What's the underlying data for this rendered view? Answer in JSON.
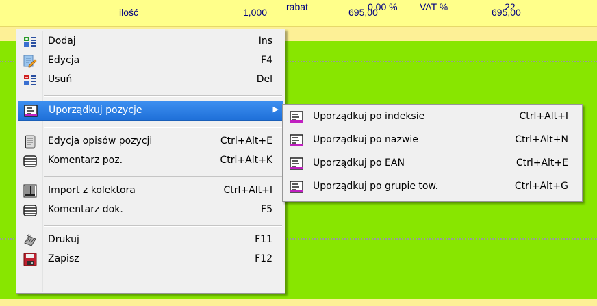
{
  "document": {
    "row1": {
      "label": "ilość",
      "qty": "1,000",
      "price": "695,00",
      "value": "695,00"
    },
    "row2": {
      "label": "rabat",
      "discount": "0,00 %",
      "vat_label": "VAT %",
      "vat": "22"
    }
  },
  "colors": {
    "highlight": "#1e6fd8",
    "workspace_green": "#88e600",
    "row_yellow": "#ffff8a",
    "menu_bg": "#f0f0f0"
  },
  "context_menu": {
    "items": [
      {
        "label": "Dodaj",
        "shortcut": "Ins",
        "icon": "add-row-icon"
      },
      {
        "label": "Edycja",
        "shortcut": "F4",
        "icon": "edit-pencil-icon"
      },
      {
        "label": "Usuń",
        "shortcut": "Del",
        "icon": "delete-row-icon"
      },
      {
        "label": "Uporządkuj pozycje",
        "shortcut": "",
        "icon": "sort-list-icon",
        "highlighted": true,
        "submenu_arrow": "▶"
      },
      {
        "label": "Edycja opisów pozycji",
        "shortcut": "Ctrl+Alt+E",
        "icon": "document-edit-icon"
      },
      {
        "label": "Komentarz poz.",
        "shortcut": "Ctrl+Alt+K",
        "icon": "comment-lines-icon"
      },
      {
        "label": "Import z kolektora",
        "shortcut": "Ctrl+Alt+I",
        "icon": "barcode-icon"
      },
      {
        "label": "Komentarz dok.",
        "shortcut": "F5",
        "icon": "comment-lines-icon"
      },
      {
        "label": "Drukuj",
        "shortcut": "F11",
        "icon": "printer-icon"
      },
      {
        "label": "Zapisz",
        "shortcut": "F12",
        "icon": "floppy-disk-icon"
      }
    ]
  },
  "submenu": {
    "items": [
      {
        "label": "Uporządkuj po indeksie",
        "shortcut": "Ctrl+Alt+I",
        "icon": "sort-list-icon"
      },
      {
        "label": "Uporządkuj po nazwie",
        "shortcut": "Ctrl+Alt+N",
        "icon": "sort-list-icon"
      },
      {
        "label": "Uporządkuj po EAN",
        "shortcut": "Ctrl+Alt+E",
        "icon": "sort-list-icon"
      },
      {
        "label": "Uporządkuj po grupie tow.",
        "shortcut": "Ctrl+Alt+G",
        "icon": "sort-list-icon"
      }
    ]
  }
}
